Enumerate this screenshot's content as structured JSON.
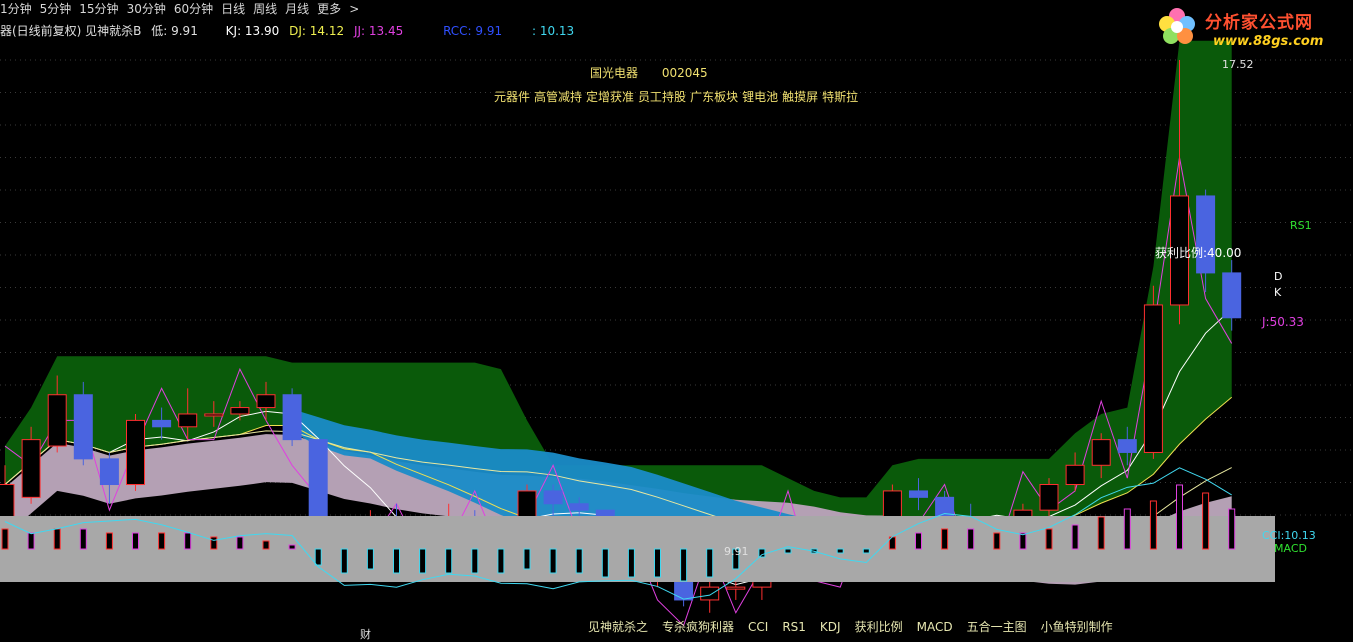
{
  "topbar": [
    "1分钟",
    "5分钟",
    "15分钟",
    "30分钟",
    "60分钟",
    "日线",
    "周线",
    "月线",
    "更多",
    ">"
  ],
  "info": {
    "indicator": "器(日线前复权) 见神就杀B",
    "low_label": "低: 9.91",
    "kj": "KJ: 13.90",
    "dj": "DJ: 14.12",
    "jj": "JJ: 13.45",
    "rcc": "RCC: 9.91",
    "cci_val": ": 10.13"
  },
  "logo": {
    "text": "分析家公式网",
    "url": "www.88gs.com"
  },
  "stock": {
    "name": "国光电器",
    "code": "002045"
  },
  "tags": [
    "元器件",
    "高管减持",
    "定增获准",
    "员工持股",
    "广东板块",
    "锂电池",
    "触摸屏",
    "特斯拉"
  ],
  "labels": {
    "high": "17.52",
    "low": "9.91",
    "rs1": "RS1",
    "profit": "获利比例:40.00",
    "d": "D",
    "k": "K",
    "j": "J:50.33",
    "cci": "CCI:10.13",
    "macd": "MACD",
    "cai": "财"
  },
  "toolbar": [
    "见神就杀之",
    "专杀疯狗利器",
    "CCI",
    "RS1",
    "KDJ",
    "获利比例",
    "MACD",
    "五合一主图",
    "小鱼特别制作"
  ],
  "colors": {
    "up": "#ff3030",
    "down": "#4a64e0",
    "green": "#0a5a0a",
    "blue": "#1a8cc8",
    "pink": "#b4a0b4",
    "magenta": "#e040e0",
    "cyan": "#40d8f0",
    "yellow": "#f0e050"
  },
  "chart_data": {
    "type": "candlestick",
    "dates_count": 48,
    "candles": [
      [
        10.1,
        10.9,
        10.0,
        11.2
      ],
      [
        10.7,
        11.6,
        10.6,
        11.8
      ],
      [
        11.5,
        12.3,
        11.4,
        12.6
      ],
      [
        12.3,
        11.3,
        11.2,
        12.5
      ],
      [
        11.3,
        10.9,
        10.6,
        11.4
      ],
      [
        10.9,
        11.9,
        10.8,
        12.0
      ],
      [
        11.9,
        11.8,
        11.6,
        12.1
      ],
      [
        11.8,
        12.0,
        11.6,
        12.4
      ],
      [
        12.0,
        12.0,
        11.8,
        12.2
      ],
      [
        12.0,
        12.1,
        11.9,
        12.2
      ],
      [
        12.1,
        12.3,
        11.9,
        12.5
      ],
      [
        12.3,
        11.6,
        11.5,
        12.4
      ],
      [
        11.6,
        10.1,
        10.0,
        11.6
      ],
      [
        10.1,
        9.85,
        9.7,
        10.3
      ],
      [
        9.85,
        10.4,
        9.6,
        10.5
      ],
      [
        10.4,
        10.0,
        9.8,
        10.6
      ],
      [
        10.0,
        10.2,
        9.9,
        10.4
      ],
      [
        10.2,
        10.4,
        10.0,
        10.6
      ],
      [
        10.4,
        10.2,
        10.0,
        10.5
      ],
      [
        10.2,
        10.2,
        10.0,
        10.3
      ],
      [
        10.2,
        10.8,
        10.0,
        10.9
      ],
      [
        10.8,
        10.6,
        10.4,
        10.9
      ],
      [
        10.6,
        10.5,
        10.3,
        10.7
      ],
      [
        10.5,
        10.0,
        9.9,
        10.5
      ],
      [
        10.0,
        9.5,
        9.4,
        10.1
      ],
      [
        9.5,
        9.5,
        9.3,
        9.6
      ],
      [
        9.5,
        9.1,
        9.0,
        9.6
      ],
      [
        9.1,
        9.3,
        8.9,
        9.4
      ],
      [
        9.3,
        9.3,
        9.1,
        9.4
      ],
      [
        9.3,
        10.0,
        9.1,
        10.2
      ],
      [
        10.0,
        10.2,
        9.8,
        10.4
      ],
      [
        10.2,
        9.8,
        9.6,
        10.4
      ],
      [
        9.8,
        9.7,
        9.6,
        10.0
      ],
      [
        9.7,
        9.8,
        9.5,
        10.0
      ],
      [
        9.8,
        10.8,
        9.7,
        10.9
      ],
      [
        10.8,
        10.7,
        10.5,
        11.0
      ],
      [
        10.7,
        10.3,
        10.0,
        10.8
      ],
      [
        10.3,
        10.1,
        9.9,
        10.6
      ],
      [
        10.1,
        10.2,
        9.9,
        10.3
      ],
      [
        10.2,
        10.5,
        10.0,
        10.6
      ],
      [
        10.5,
        10.9,
        10.4,
        11.0
      ],
      [
        10.9,
        11.2,
        10.8,
        11.4
      ],
      [
        11.2,
        11.6,
        11.0,
        11.7
      ],
      [
        11.6,
        11.4,
        11.2,
        11.8
      ],
      [
        11.4,
        13.7,
        11.3,
        14.0
      ],
      [
        13.7,
        15.4,
        13.4,
        17.52
      ],
      [
        15.4,
        14.2,
        13.9,
        15.5
      ],
      [
        14.2,
        13.5,
        13.3,
        14.4
      ]
    ],
    "low_marker": 9.91,
    "high_marker": 17.52,
    "profit_ratio": 40.0,
    "j": 50.33,
    "cci": 10.13,
    "macd_hist": [
      0.5,
      0.4,
      0.5,
      0.5,
      0.4,
      0.4,
      0.4,
      0.4,
      0.3,
      0.3,
      0.2,
      0.1,
      -0.4,
      -0.6,
      -0.5,
      -0.6,
      -0.6,
      -0.6,
      -0.6,
      -0.6,
      -0.5,
      -0.6,
      -0.6,
      -0.7,
      -0.7,
      -0.7,
      -0.8,
      -0.7,
      -0.5,
      -0.2,
      -0.1,
      -0.1,
      -0.1,
      -0.1,
      0.3,
      0.4,
      0.5,
      0.5,
      0.4,
      0.4,
      0.5,
      0.6,
      0.8,
      1.0,
      1.2,
      1.6,
      1.4,
      1.0
    ]
  }
}
